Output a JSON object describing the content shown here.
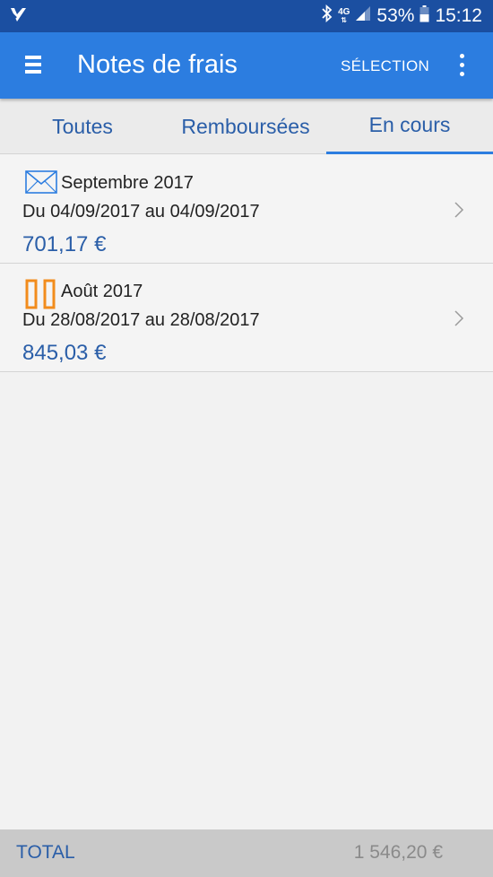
{
  "status_bar": {
    "network_top": "4G",
    "battery_percent": "53%",
    "time": "15:12"
  },
  "app_bar": {
    "title": "Notes de frais",
    "selection_label": "SÉLECTION"
  },
  "tabs": [
    {
      "label": "Toutes"
    },
    {
      "label": "Remboursées"
    },
    {
      "label": "En cours",
      "active": true
    }
  ],
  "expenses": [
    {
      "title": "Septembre 2017",
      "dates": "Du 04/09/2017 au 04/09/2017",
      "amount": "701,17 €",
      "status_icon": "envelope-icon"
    },
    {
      "title": "Août 2017",
      "dates": "Du 28/08/2017 au 28/08/2017",
      "amount": "845,03 €",
      "status_icon": "pause-icon"
    }
  ],
  "footer": {
    "total_label": "TOTAL",
    "total_value": "1 546,20 €"
  },
  "colors": {
    "status_bar": "#1b4fa1",
    "app_bar": "#2c7de0",
    "accent_text": "#2a5ea8",
    "pending_orange": "#f28c1c"
  }
}
